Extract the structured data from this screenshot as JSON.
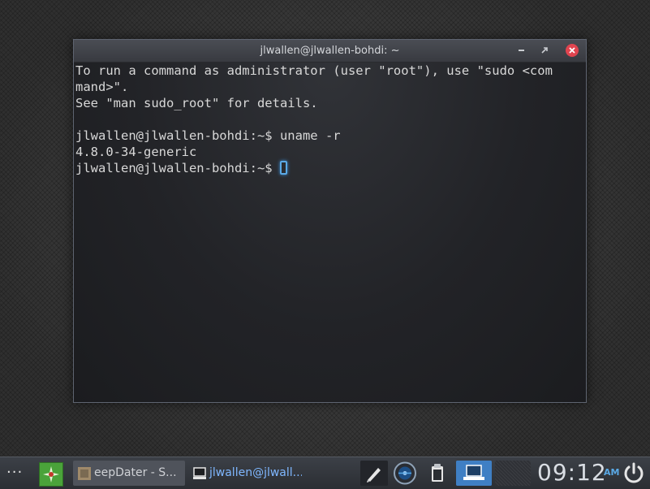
{
  "window": {
    "title": "jlwallen@jlwallen-bohdi: ~",
    "buttons": [
      "minimize",
      "maximize",
      "close"
    ]
  },
  "terminal": {
    "lines": [
      "To run a command as administrator (user \"root\"), use \"sudo <com",
      "mand>\".",
      "See \"man sudo_root\" for details.",
      "",
      "jlwallen@jlwallen-bohdi:~$ uname -r",
      "4.8.0-34-generic"
    ],
    "prompt": "jlwallen@jlwallen-bohdi:~$ "
  },
  "taskbar": {
    "menu_label": "···",
    "tasks": [
      {
        "label": "eepDater - S..."
      },
      {
        "label": "jlwallen@jlwall..."
      }
    ],
    "clock": "09:12",
    "ampm": "AM"
  },
  "colors": {
    "accent": "#5aa9e6",
    "close": "#e0444f",
    "launcher": "#4aa33a"
  }
}
